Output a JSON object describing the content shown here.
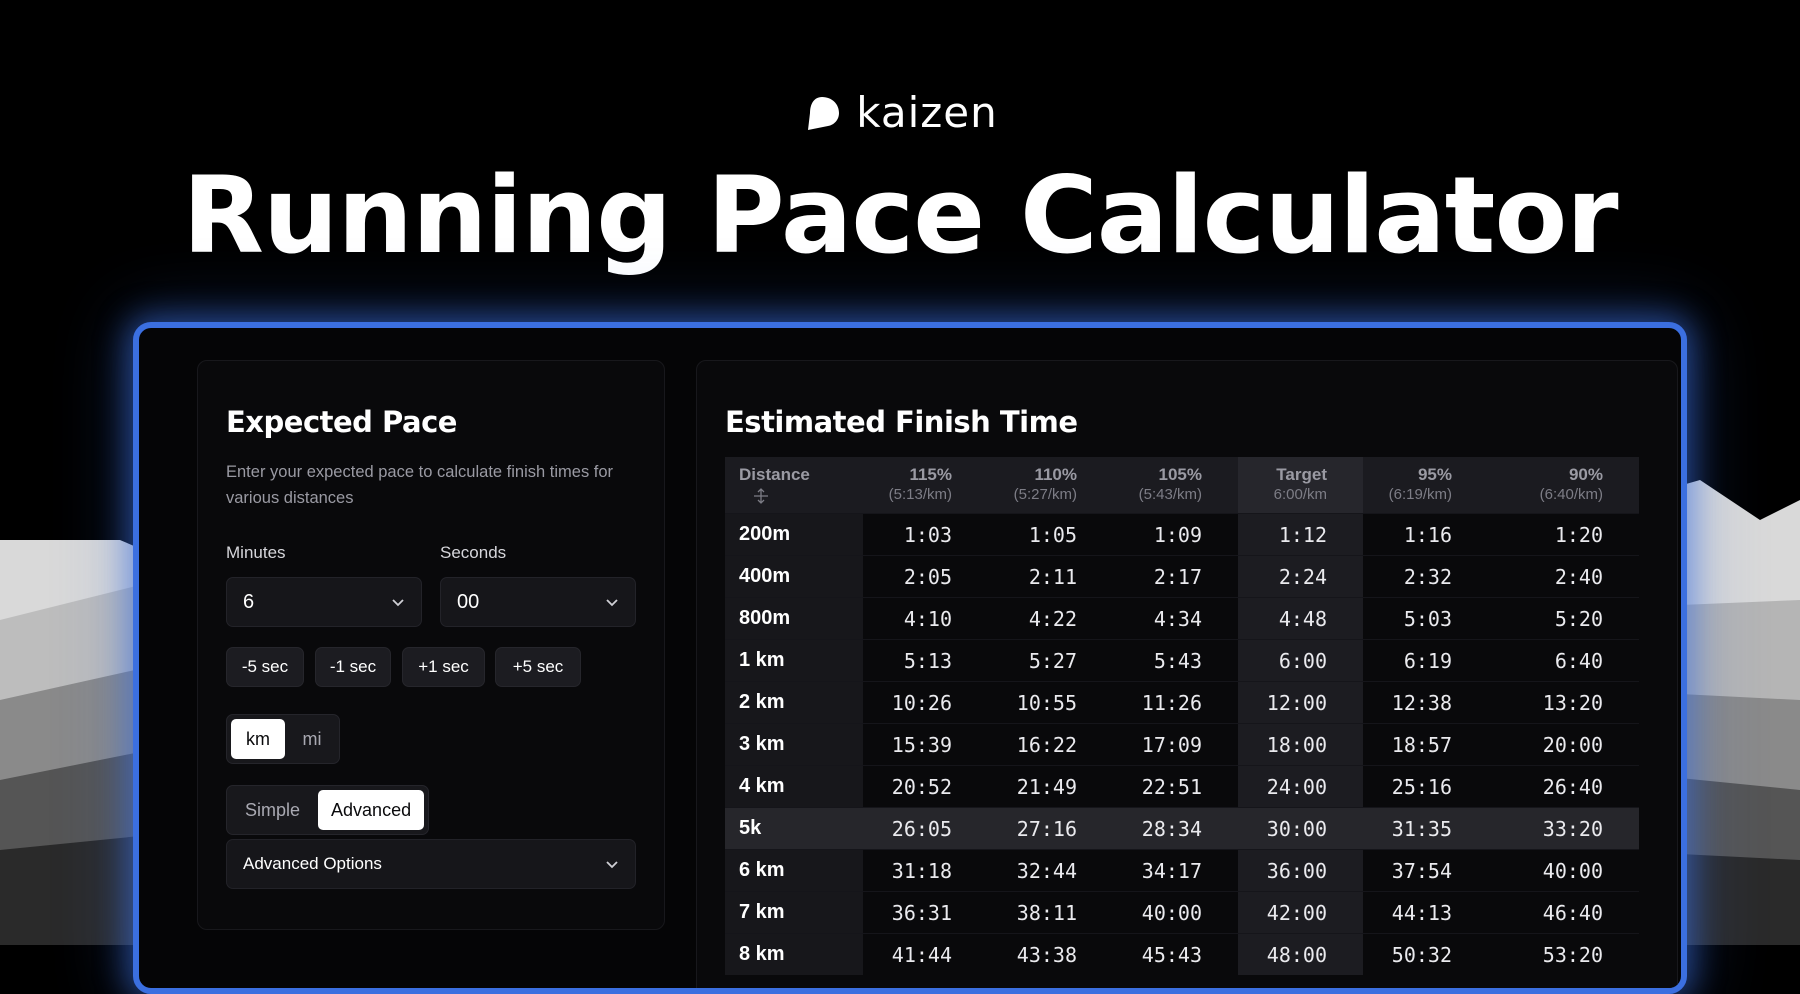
{
  "brand": {
    "name": "kaizen"
  },
  "hero": {
    "title": "Running Pace Calculator"
  },
  "expected_pace": {
    "title": "Expected Pace",
    "subtitle": "Enter your expected pace to calculate finish times for various distances",
    "minutes": {
      "label": "Minutes",
      "value": "6"
    },
    "seconds": {
      "label": "Seconds",
      "value": "00"
    },
    "step_buttons": [
      "-5 sec",
      "-1 sec",
      "+1 sec",
      "+5 sec"
    ],
    "units": {
      "options": [
        "km",
        "mi"
      ],
      "selected": "km"
    },
    "modes": {
      "options": [
        "Simple",
        "Advanced"
      ],
      "selected": "Advanced"
    },
    "advanced_options": {
      "label": "Advanced Options"
    }
  },
  "finish_time": {
    "title": "Estimated Finish Time",
    "columns": [
      {
        "pct": "Distance",
        "pace": ""
      },
      {
        "pct": "115%",
        "pace": "(5:13/km)"
      },
      {
        "pct": "110%",
        "pace": "(5:27/km)"
      },
      {
        "pct": "105%",
        "pace": "(5:43/km)"
      },
      {
        "pct": "Target",
        "pace": "6:00/km"
      },
      {
        "pct": "95%",
        "pace": "(6:19/km)"
      },
      {
        "pct": "90%",
        "pace": "(6:40/km)"
      }
    ],
    "rows": [
      {
        "distance": "200m",
        "times": [
          "1:03",
          "1:05",
          "1:09",
          "1:12",
          "1:16",
          "1:20"
        ]
      },
      {
        "distance": "400m",
        "times": [
          "2:05",
          "2:11",
          "2:17",
          "2:24",
          "2:32",
          "2:40"
        ]
      },
      {
        "distance": "800m",
        "times": [
          "4:10",
          "4:22",
          "4:34",
          "4:48",
          "5:03",
          "5:20"
        ]
      },
      {
        "distance": "1 km",
        "times": [
          "5:13",
          "5:27",
          "5:43",
          "6:00",
          "6:19",
          "6:40"
        ]
      },
      {
        "distance": "2 km",
        "times": [
          "10:26",
          "10:55",
          "11:26",
          "12:00",
          "12:38",
          "13:20"
        ]
      },
      {
        "distance": "3 km",
        "times": [
          "15:39",
          "16:22",
          "17:09",
          "18:00",
          "18:57",
          "20:00"
        ]
      },
      {
        "distance": "4 km",
        "times": [
          "20:52",
          "21:49",
          "22:51",
          "24:00",
          "25:16",
          "26:40"
        ]
      },
      {
        "distance": "5k",
        "times": [
          "26:05",
          "27:16",
          "28:34",
          "30:00",
          "31:35",
          "33:20"
        ],
        "highlight": true
      },
      {
        "distance": "6 km",
        "times": [
          "31:18",
          "32:44",
          "34:17",
          "36:00",
          "37:54",
          "40:00"
        ]
      },
      {
        "distance": "7 km",
        "times": [
          "36:31",
          "38:11",
          "40:00",
          "42:00",
          "44:13",
          "46:40"
        ]
      },
      {
        "distance": "8 km",
        "times": [
          "41:44",
          "43:38",
          "45:43",
          "48:00",
          "50:32",
          "53:20"
        ]
      }
    ]
  },
  "colors": {
    "accent": "#3b6fe0",
    "background": "#000000",
    "panel": "#09090b"
  }
}
